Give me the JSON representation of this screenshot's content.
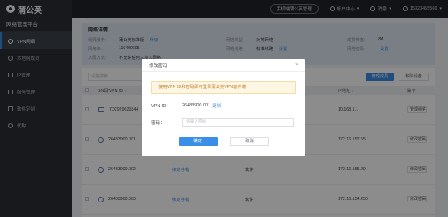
{
  "brand": {
    "name": "蒲公英",
    "platform": "网络管理平台"
  },
  "sidebar": {
    "items": [
      {
        "label": "VPN网络",
        "active": true
      },
      {
        "label": "本地网成员",
        "active": false
      },
      {
        "label": "IP管理",
        "active": false
      },
      {
        "label": "服务管理",
        "active": false
      },
      {
        "label": "软件定制",
        "active": false
      },
      {
        "label": "代购",
        "active": false
      }
    ]
  },
  "topbar": {
    "pill": "手机端蒲公英管理",
    "account_menu": "帐户中心",
    "messages": "消息",
    "phone": "15323455566"
  },
  "detail": {
    "title": "网络详情",
    "rows": [
      [
        {
          "k": "组网服务:",
          "v": "蒲公英标准版",
          "link": "升级"
        },
        {
          "k": "网络类型:",
          "v": "对等网络"
        },
        {
          "k": "成员带宽:",
          "v": "2M"
        }
      ],
      [
        {
          "k": "网络ID:",
          "v": "119409605"
        },
        {
          "k": "网络线路:",
          "v": "标准线路",
          "link": "设置"
        },
        {
          "k": "网络密码:",
          "v": "",
          "link": "设置"
        }
      ],
      [
        {
          "k": "入网方式:",
          "v": "不允许任何人加入网络"
        },
        {
          "k": "",
          "v": ""
        },
        {
          "k": "",
          "v": ""
        }
      ]
    ]
  },
  "toolbar": {
    "search_placeholder": "设备搜索",
    "manage_members": "管理成员",
    "remove_device": "移除设备"
  },
  "table": {
    "headers": {
      "sn": "SN码/VPN ID ↕",
      "ip": "IP地址 ↕",
      "op": "操作"
    },
    "rows": [
      {
        "sn": "7D2929021844",
        "a": "",
        "b": "",
        "ip": "10.168.1.1",
        "op": "管理组件",
        "icon": "router"
      },
      {
        "sn": "26483900.001",
        "a": "",
        "b": "",
        "ip": "172.16.157.55",
        "op": "修改密码",
        "icon": "user"
      },
      {
        "sn": "26483900.002",
        "a": "绑定手机",
        "b": "软件",
        "ip": "172.16.155.29",
        "op": "修改密码",
        "icon": "user"
      },
      {
        "sn": "26483900.003",
        "a": "绑定手机",
        "b": "软件",
        "ip": "172.16.154.250",
        "op": "修改密码",
        "icon": "user"
      }
    ]
  },
  "dialog": {
    "title": "修改密码",
    "close": "×",
    "tip": "使用VPN ID和密码即可登录蒲公英VPN客户端",
    "vpn_id_label": "VPN ID：",
    "vpn_id_value": "26483900.001",
    "copy": "复制",
    "password_label": "密码：",
    "password_placeholder": "请输入密码",
    "ok": "确定",
    "cancel": "取消"
  }
}
